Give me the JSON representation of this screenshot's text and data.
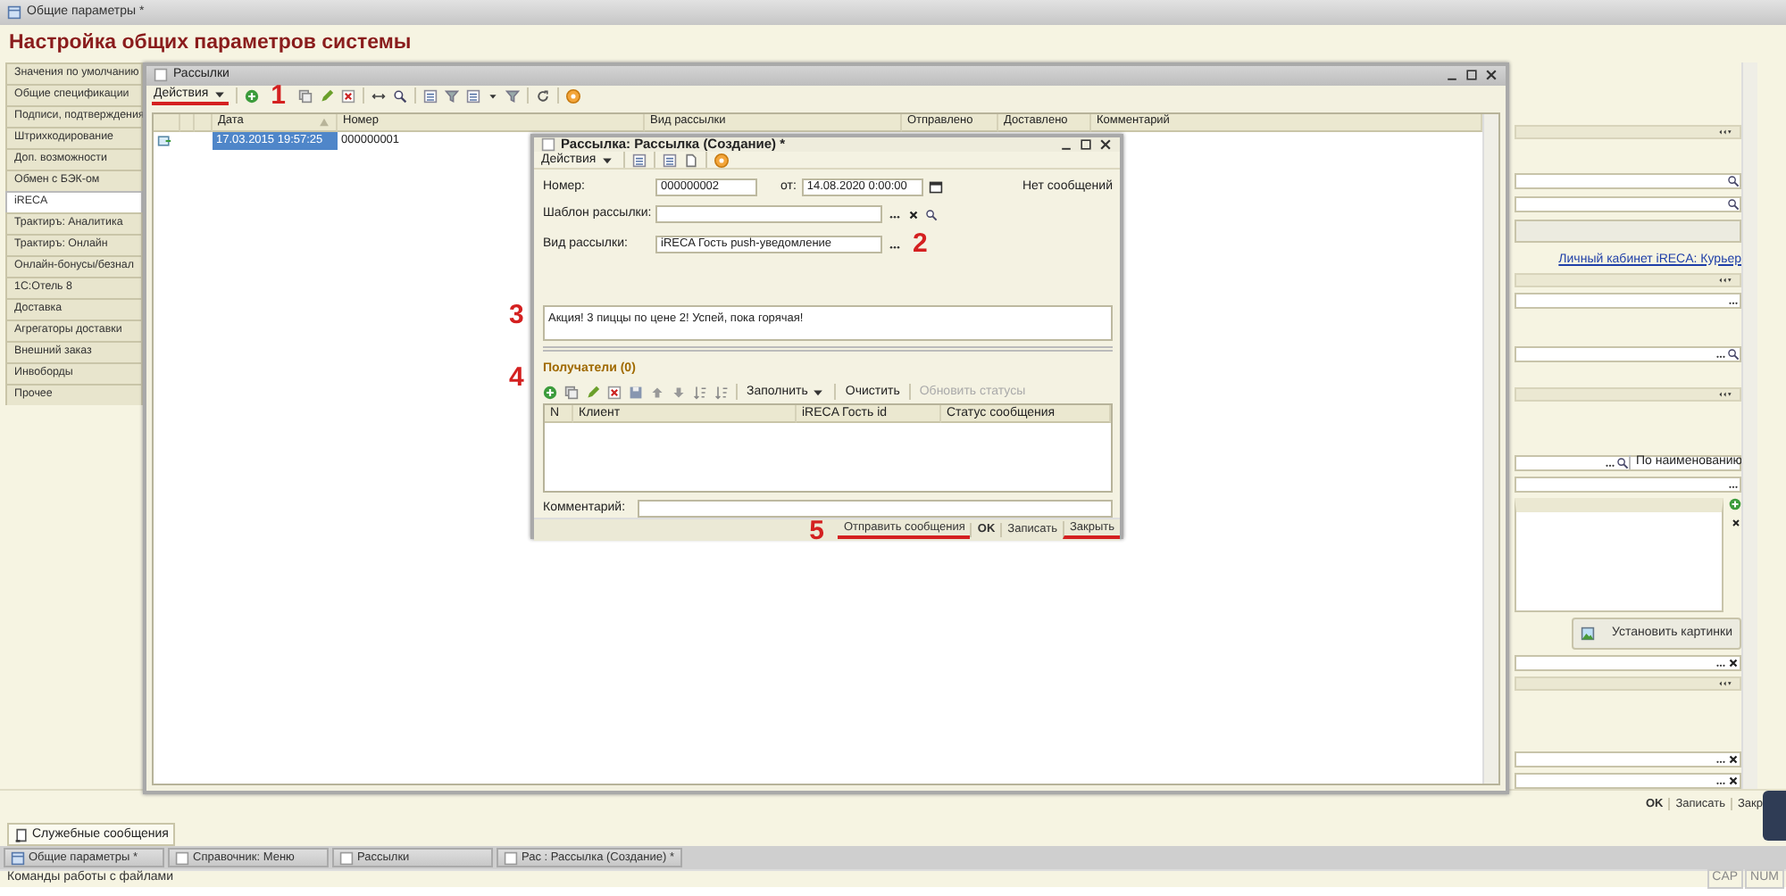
{
  "app_title": "Общие параметры *",
  "page_title": "Настройка общих параметров системы",
  "side_tabs": [
    {
      "label": "Значения по умолчанию",
      "selected": false
    },
    {
      "label": "Общие спецификации",
      "selected": false
    },
    {
      "label": "Подписи, подтверждения",
      "selected": false
    },
    {
      "label": "Штрихкодирование",
      "selected": false
    },
    {
      "label": "Доп. возможности",
      "selected": false
    },
    {
      "label": "Обмен с БЭК-ом",
      "selected": false
    },
    {
      "label": "iRECA",
      "selected": true
    },
    {
      "label": "Трактиръ: Аналитика",
      "selected": false
    },
    {
      "label": "Трактиръ: Онлайн",
      "selected": false
    },
    {
      "label": "Онлайн-бонусы/безнал",
      "selected": false
    },
    {
      "label": "1С:Отель 8",
      "selected": false
    },
    {
      "label": "Доставка",
      "selected": false
    },
    {
      "label": "Агрегаторы доставки",
      "selected": false
    },
    {
      "label": "Внешний заказ",
      "selected": false
    },
    {
      "label": "Инвоборды",
      "selected": false
    },
    {
      "label": "Прочее",
      "selected": false
    }
  ],
  "right_panel": {
    "link": "Личный кабинет iRECA: Курьер",
    "sort_field": "По наименованию",
    "button": "Установить картинки"
  },
  "list_window": {
    "title": "Рассылки",
    "actions": {
      "label": "Действия",
      "underlined": true
    },
    "columns": [
      "Дата",
      "Номер",
      "Вид рассылки",
      "Отправлено",
      "Доставлено",
      "Комментарий"
    ],
    "rows": [
      {
        "date": "17.03.2015 19:57:25",
        "number": "000000001",
        "selected": true
      }
    ]
  },
  "dialog": {
    "title": "Рассылка: Рассылка (Создание) *",
    "actions": "Действия",
    "number_label": "Номер:",
    "number": "000000002",
    "date_label": "от:",
    "date": "14.08.2020 0:00:00",
    "status_text": "Нет сообщений",
    "template_label": "Шаблон рассылки:",
    "type_label": "Вид рассылки:",
    "type": "iRECA Гость push-уведомление",
    "message": "Акция! 3 пиццы по цене 2! Успей, пока горячая!",
    "recipients_title": "Получатели (0)",
    "recipient_tools": [
      {
        "label": "Заполнить",
        "kind": "menu",
        "disabled": false
      },
      {
        "label": "Очистить",
        "kind": "button",
        "disabled": false
      },
      {
        "label": "Обновить статусы",
        "kind": "button",
        "disabled": true
      }
    ],
    "recipient_columns": [
      "N",
      "Клиент",
      "iRECA Гость id",
      "Статус сообщения"
    ],
    "comment_label": "Комментарий:",
    "buttons": [
      {
        "label": "Отправить сообщения",
        "default": false,
        "underlined": true
      },
      {
        "label": "OK",
        "default": true,
        "underlined": false
      },
      {
        "label": "Записать",
        "default": false,
        "underlined": false
      },
      {
        "label": "Закрыть",
        "default": false,
        "underlined": true
      }
    ]
  },
  "annotations": [
    "1",
    "2",
    "3",
    "4",
    "5"
  ],
  "form_buttons": [
    {
      "label": "OK",
      "default": true
    },
    {
      "label": "Записать",
      "default": false
    },
    {
      "label": "Закр",
      "default": false
    }
  ],
  "messages_tab": "Служебные сообщения",
  "taskbar": [
    "Общие параметры *",
    "Справочник: Меню",
    "Рассылки",
    "Рас : Рассылка (Создание) *"
  ],
  "status_bar": {
    "text": "Команды работы с файлами",
    "indicators": [
      "CAP",
      "NUM"
    ]
  }
}
